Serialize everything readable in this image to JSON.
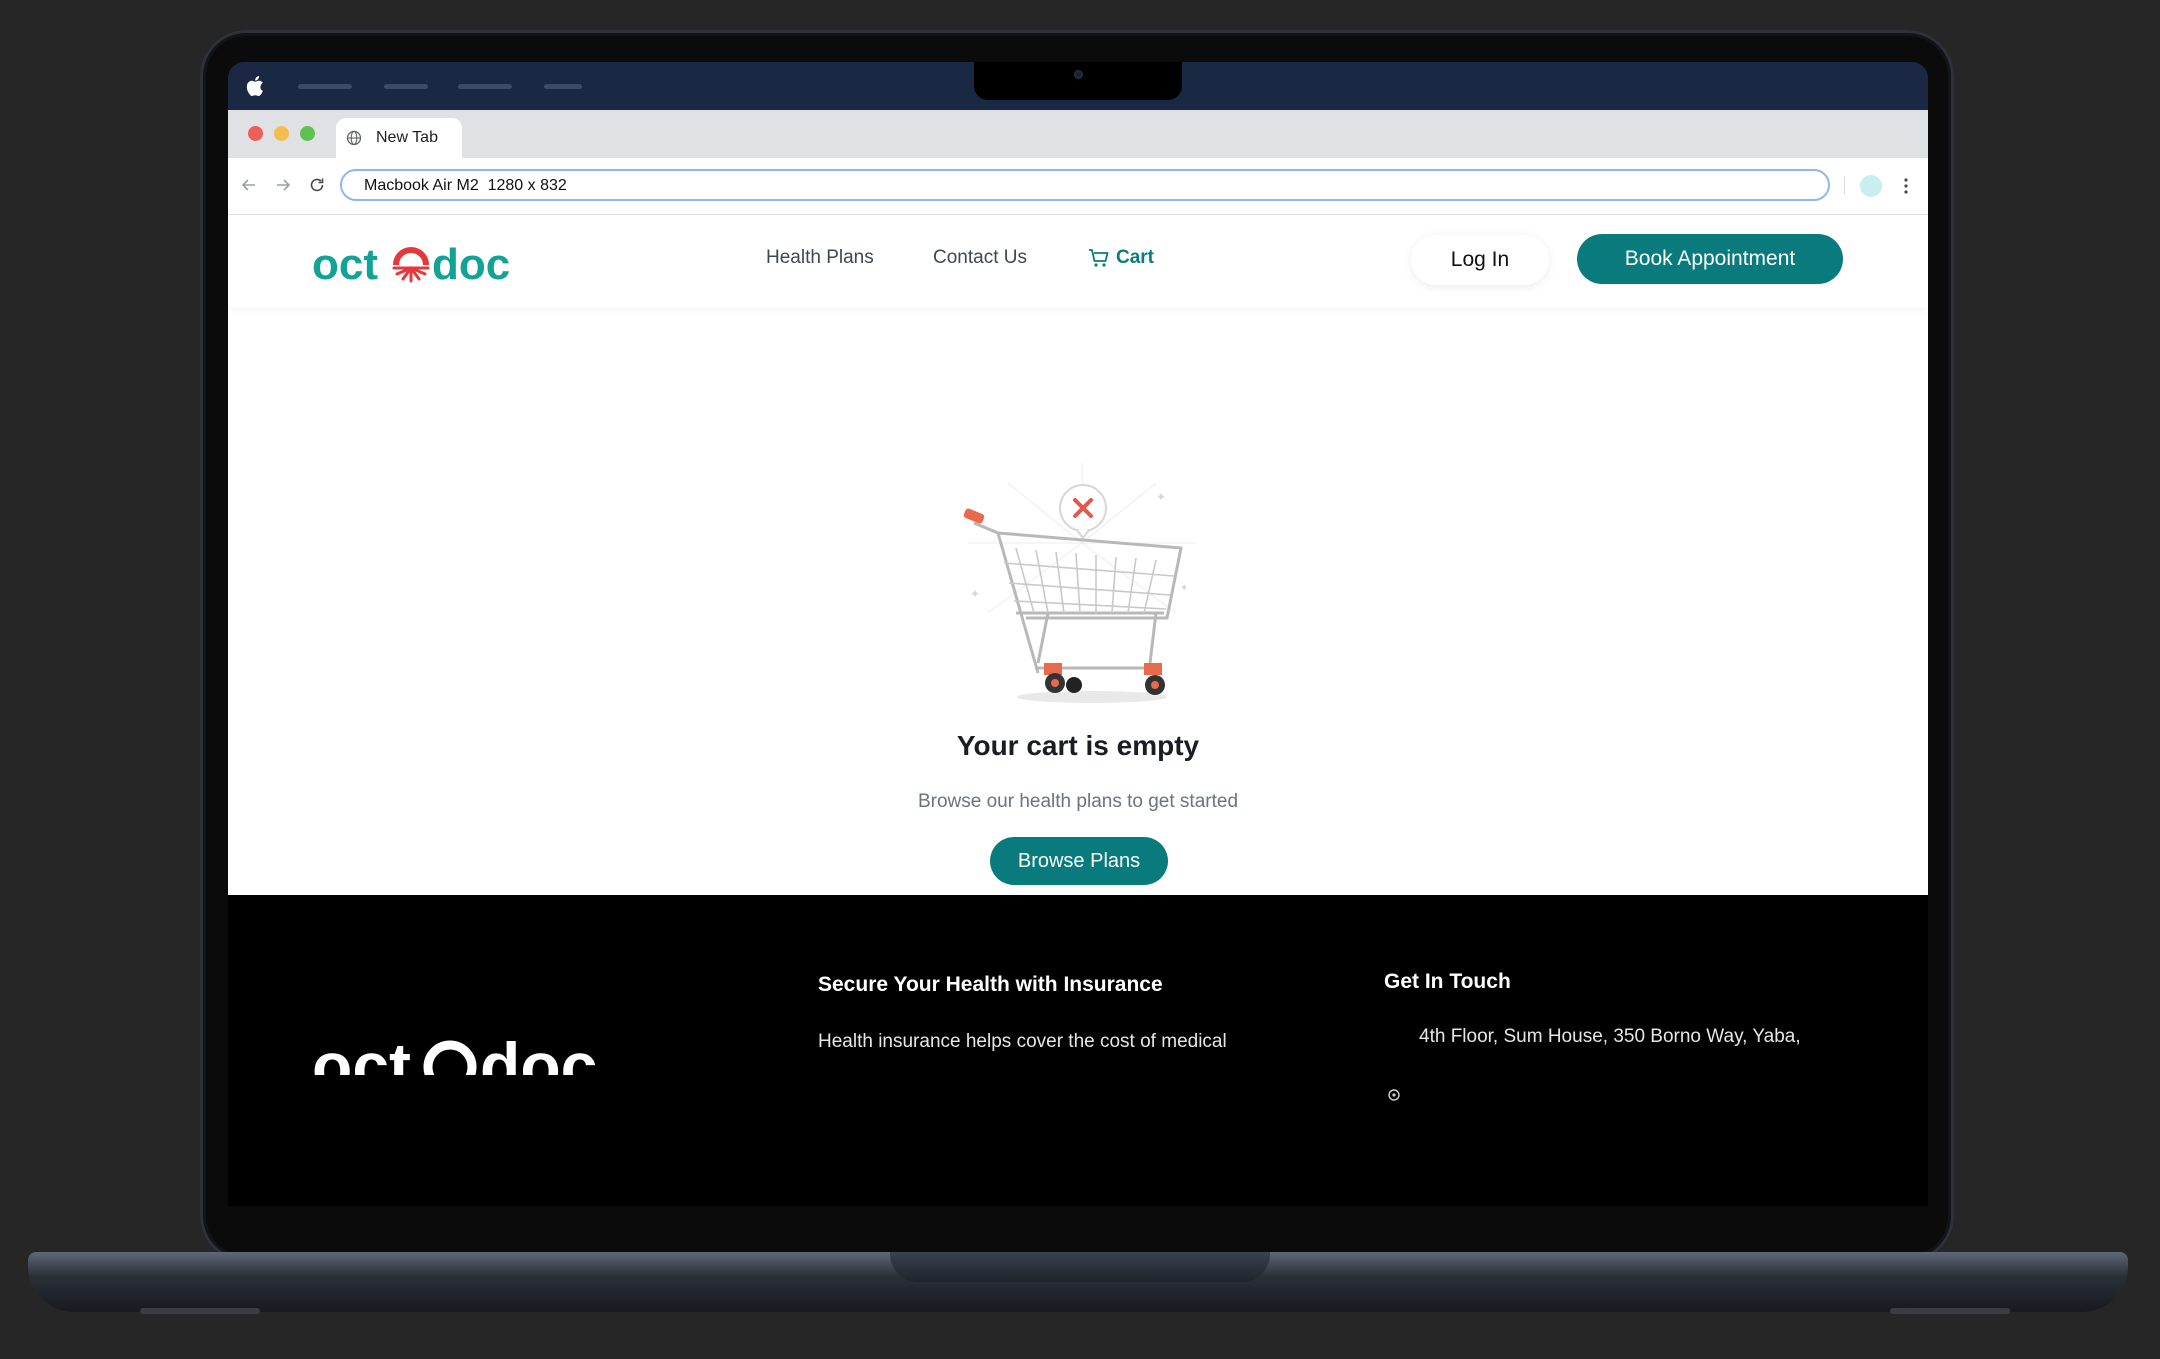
{
  "browser": {
    "tab_title": "New Tab",
    "address": "Macbook Air M2  1280 x 832"
  },
  "site": {
    "brand": {
      "part1": "oct",
      "part2": "doc"
    },
    "nav": {
      "health_plans": "Health Plans",
      "contact_us": "Contact Us",
      "cart": "Cart"
    },
    "login_label": "Log In",
    "book_label": "Book Appointment",
    "empty_cart": {
      "title": "Your cart is empty",
      "subtitle": "Browse our health plans to get started",
      "button": "Browse Plans"
    },
    "footer": {
      "insurance_heading": "Secure Your Health with Insurance",
      "insurance_text": "Health insurance helps cover the cost of medical",
      "contact_heading": "Get In Touch",
      "address": "4th Floor, Sum House, 350 Borno Way, Yaba,"
    }
  },
  "colors": {
    "brand_teal": "#0a7b7d",
    "logo_teal": "#11a396",
    "logo_red": "#e5383b",
    "menubar": "#1b2844"
  }
}
